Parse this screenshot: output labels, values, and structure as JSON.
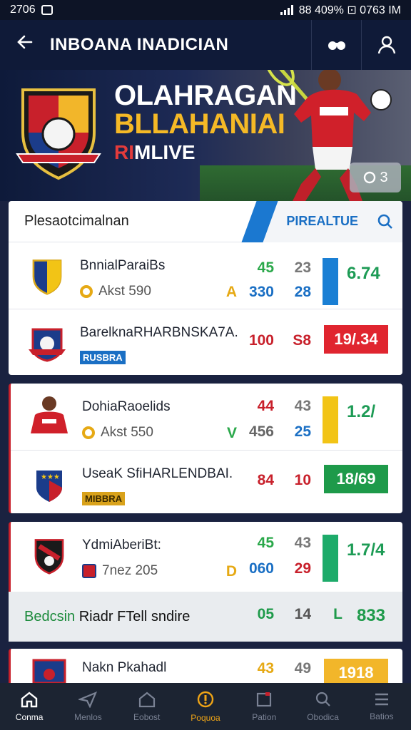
{
  "status_bar": {
    "time": "2706",
    "right_text": "88 409% ⊡ 0763 IM"
  },
  "header": {
    "title": "INBOANA INADICIAN"
  },
  "banner": {
    "line1": "OLAHRAGAN",
    "line2": "BLLAHANIAI",
    "line3_red": "RI",
    "line3_white": "MLIVE",
    "badge_count": "3"
  },
  "card_header": {
    "label": "Plesaotcimalnan",
    "tab_label": "PIREALTUE"
  },
  "matches": [
    {
      "team1": "BnnialParaiBs",
      "sub1": "Akst 590",
      "letter": "A",
      "letter_color": "#e6a914",
      "a1": "45",
      "a1_color": "#2aa84a",
      "b1": "23",
      "a2": "330",
      "a2_color": "#1a6fc4",
      "b2": "28",
      "b2_color": "#1a6fc4",
      "bar_color": "#1a7fd4",
      "value": "6.74",
      "team2": "BarelknaRHARBNSKA7A.",
      "tag2": "RUSBRA",
      "tag2_style": "blue",
      "c1": "100",
      "c2": "S8",
      "c_color": "#c8202b",
      "box2": "19/.34",
      "box2_color": "#e0252f"
    },
    {
      "team1": "DohiaRaoelids",
      "sub1": "Akst 550",
      "letter": "V",
      "letter_color": "#2aa84a",
      "a1": "44",
      "a1_color": "#c8202b",
      "b1": "43",
      "a2": "456",
      "a2_color": "#555",
      "b2": "25",
      "b2_color": "#1a6fc4",
      "bar_color": "#f2c416",
      "value": "1.2/",
      "team2": "UseaK SfiHARLENDBAI.",
      "tag2": "MIBBRA",
      "tag2_style": "gold",
      "c1": "84",
      "c2": "10",
      "c_color": "#c8202b",
      "box2": "18/69",
      "box2_color": "#1e9a4a"
    },
    {
      "team1": "YdmiAberiBt:",
      "sub1": "7nez 205",
      "letter": "D",
      "letter_color": "#e6a914",
      "a1": "45",
      "a1_color": "#2aa84a",
      "b1": "43",
      "a2": "060",
      "a2_color": "#1a6fc4",
      "b2": "29",
      "b2_color": "#c8202b",
      "bar_color": "#1dab6a",
      "value": "1.7/4"
    }
  ],
  "summary": {
    "label_green": "Bedcsin",
    "label_black": "Riadr FTell sndire",
    "v1": "05",
    "v2": "14",
    "v3": "L",
    "v4": "833"
  },
  "last_match": {
    "team": "Nakn Pkahadl",
    "v1": "43",
    "v2": "49",
    "box": "1918"
  },
  "bottom_nav": [
    {
      "label": "Conma",
      "icon": "home-icon"
    },
    {
      "label": "Menlos",
      "icon": "paper-plane-icon"
    },
    {
      "label": "Eobost",
      "icon": "house-icon"
    },
    {
      "label": "Poquoa",
      "icon": "compass-icon"
    },
    {
      "label": "Pation",
      "icon": "calendar-icon"
    },
    {
      "label": "Obodica",
      "icon": "search-icon"
    },
    {
      "label": "Batios",
      "icon": "menu-icon"
    }
  ],
  "colors": {
    "accent_blue": "#1a6fc4",
    "accent_red": "#c8202b",
    "accent_green": "#1e9a4a",
    "accent_gold": "#f0a516"
  }
}
